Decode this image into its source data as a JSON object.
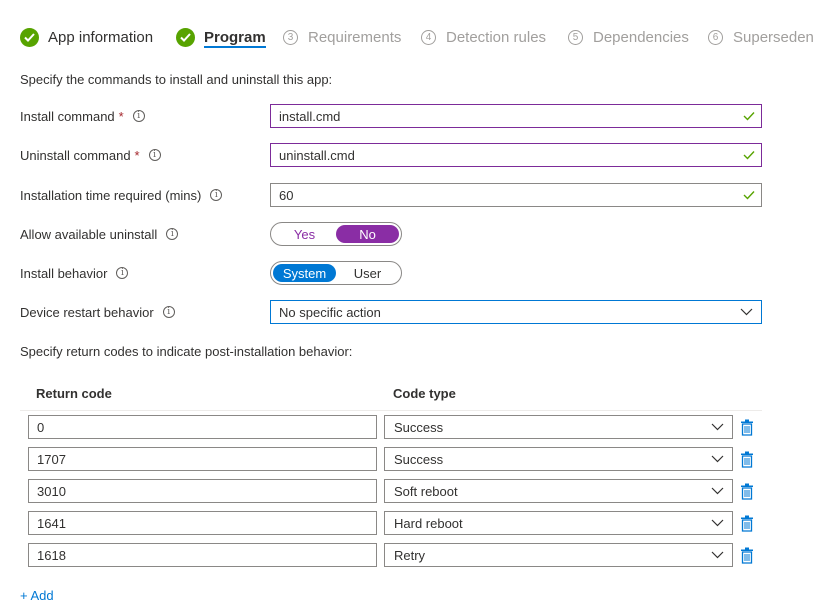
{
  "steps": [
    {
      "label": "App information",
      "state": "done"
    },
    {
      "label": "Program",
      "state": "active"
    },
    {
      "number": "3",
      "label": "Requirements",
      "state": "todo"
    },
    {
      "number": "4",
      "label": "Detection rules",
      "state": "todo"
    },
    {
      "number": "5",
      "label": "Dependencies",
      "state": "todo"
    },
    {
      "number": "6",
      "label": "Supersedenc",
      "state": "todo"
    }
  ],
  "intro_text": "Specify the commands to install and uninstall this app:",
  "fields": {
    "install_command": {
      "label": "Install command",
      "required_mark": "*",
      "value": "install.cmd"
    },
    "uninstall_command": {
      "label": "Uninstall command",
      "required_mark": "*",
      "value": "uninstall.cmd"
    },
    "install_time": {
      "label": "Installation time required (mins)",
      "value": "60"
    },
    "allow_uninstall": {
      "label": "Allow available uninstall",
      "options": [
        "Yes",
        "No"
      ],
      "selected": "No"
    },
    "install_behavior": {
      "label": "Install behavior",
      "options": [
        "System",
        "User"
      ],
      "selected": "System"
    },
    "restart_behavior": {
      "label": "Device restart behavior",
      "value": "No specific action"
    }
  },
  "info_glyph": "i",
  "return_codes_text": "Specify return codes to indicate post-installation behavior:",
  "table": {
    "headers": {
      "return_code": "Return code",
      "code_type": "Code type"
    },
    "rows": [
      {
        "code": "0",
        "type": "Success"
      },
      {
        "code": "1707",
        "type": "Success"
      },
      {
        "code": "3010",
        "type": "Soft reboot"
      },
      {
        "code": "1641",
        "type": "Hard reboot"
      },
      {
        "code": "1618",
        "type": "Retry"
      }
    ]
  },
  "add_label": "+ Add",
  "colors": {
    "accent_blue": "#0078d4",
    "success_green": "#57a300",
    "toggle_purple": "#8a2da5",
    "valid_border": "#7c2b99",
    "required_red": "#a4262c"
  }
}
